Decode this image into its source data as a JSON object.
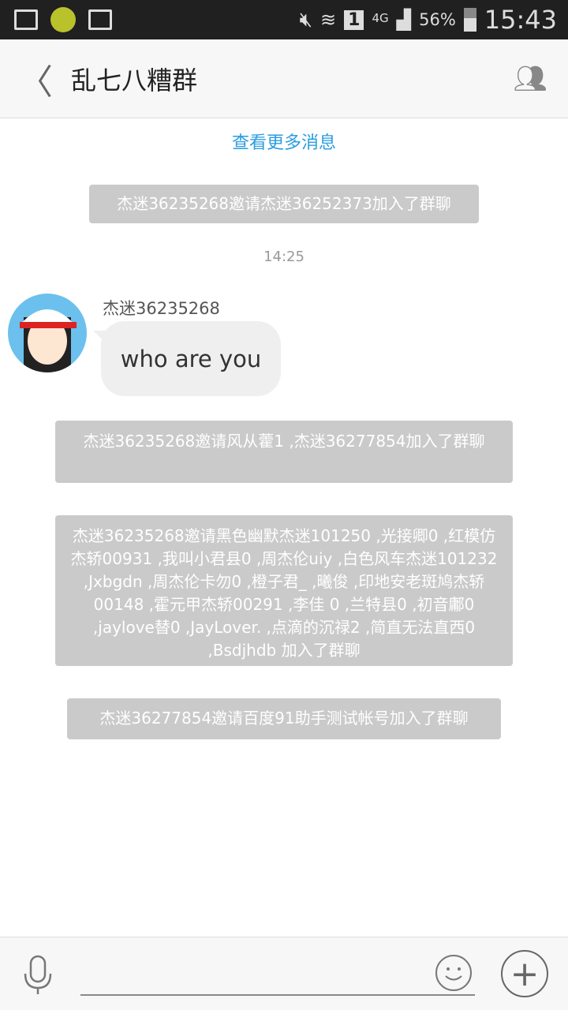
{
  "status_bar": {
    "icons": [
      "mail-icon",
      "app-notification-icon",
      "gallery-icon",
      "mute-icon",
      "wifi-icon",
      "sim-icon",
      "signal-icon",
      "battery-icon"
    ],
    "network": "4G",
    "sim": "1",
    "battery": "56%",
    "time": "15:43"
  },
  "header": {
    "title": "乱七八糟群",
    "back_icon": "chevron-left-icon",
    "members_icon": "group-icon"
  },
  "chat": {
    "load_more": "查看更多消息",
    "system_1": "杰迷36235268邀请杰迷36252373加入了群聊",
    "timestamp": "14:25",
    "message": {
      "sender": "杰迷36235268",
      "text": "who are you"
    },
    "system_2": "杰迷36235268邀请风从藿1 ,杰迷36277854加入了群聊",
    "system_3": "杰迷36235268邀请黑色幽默杰迷101250 ,光接卿0 ,红模仿杰轿00931 ,我叫小君县0 ,周杰伦uiy ,白色风车杰迷101232 ,Jxbgdn ,周杰伦卡勿0 ,橙子君_ ,曦俊 ,印地安老斑鸠杰轿00148 ,霍元甲杰轿00291 ,李佳 0 ,兰特县0 ,初音鄘0 ,jaylove替0 ,JayLover. ,点滴的沉禄2 ,简直无法直西0 ,Bsdjhdb 加入了群聊",
    "system_4": "杰迷36277854邀请百度91助手测试帐号加入了群聊"
  },
  "input": {
    "value": "",
    "mic_icon": "microphone-icon",
    "emoji_icon": "smiley-icon",
    "plus_icon": "plus-icon"
  },
  "colors": {
    "accent": "#2a9de0",
    "system_bg": "#cacaca"
  }
}
